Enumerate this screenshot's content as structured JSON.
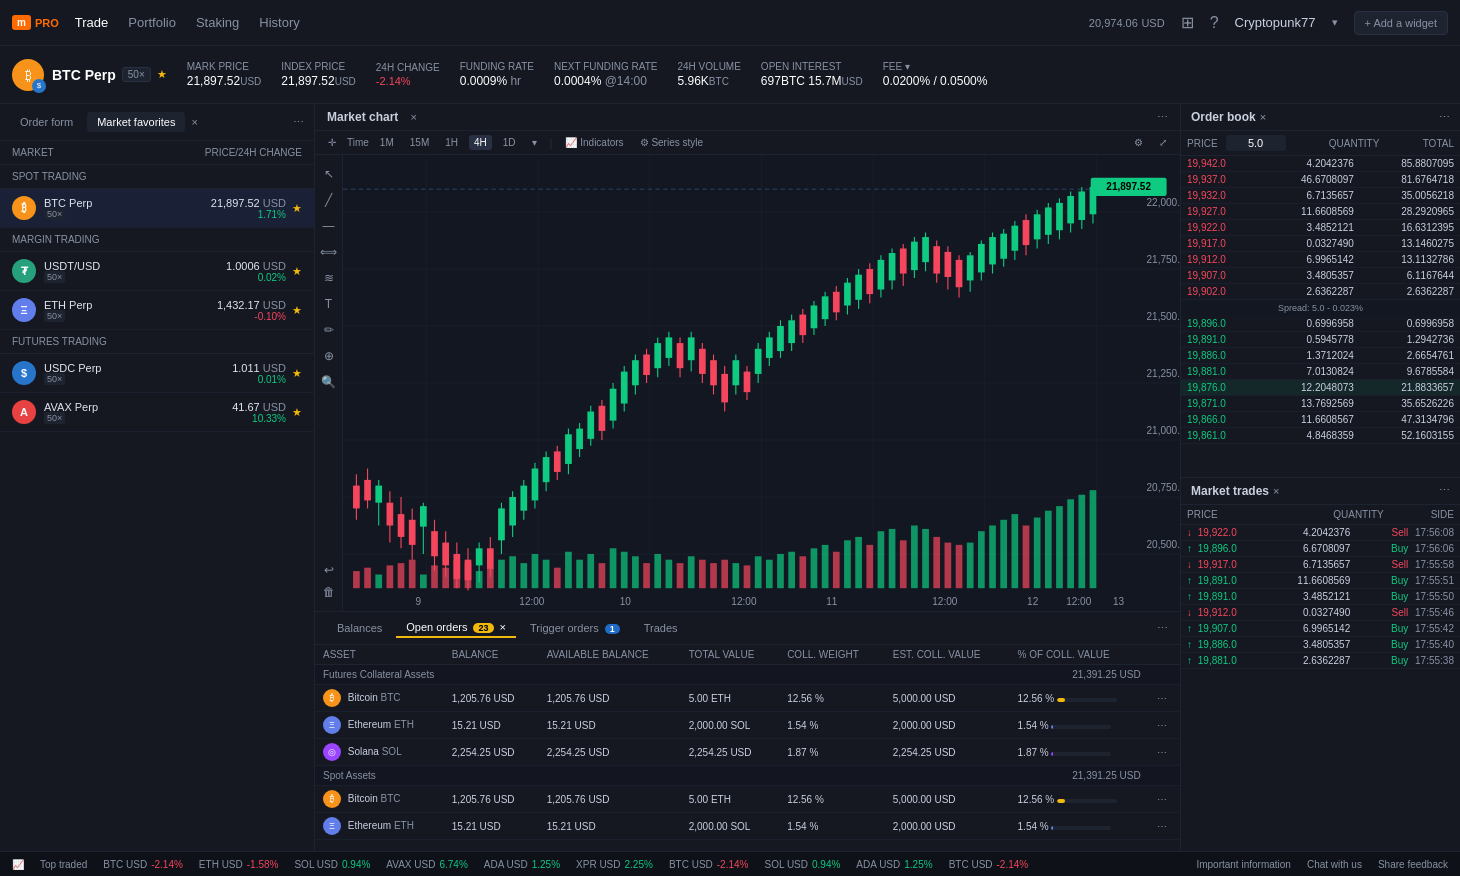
{
  "nav": {
    "logo": "m",
    "logo_pro": "PRO",
    "trade": "Trade",
    "portfolio": "Portfolio",
    "staking": "Staking",
    "history": "History",
    "balance": "20,974.06",
    "balance_currency": "USD",
    "username": "Cryptopunk77",
    "add_widget": "+ Add a widget"
  },
  "market_bar": {
    "asset": "BTC Perp",
    "leverage": "50×",
    "mark_price_label": "MARK PRICE",
    "mark_price": "21,897.52",
    "mark_price_cur": "USD",
    "index_price_label": "INDEX PRICE",
    "index_price": "21,897.52",
    "index_price_cur": "USD",
    "change_label": "24H CHANGE",
    "change": "-2.14%",
    "funding_label": "FUNDING RATE",
    "funding": "0.0009%",
    "funding_interval": "hr",
    "next_funding_label": "NEXT FUNDING RATE",
    "next_funding": "0.0004%",
    "next_funding_time": "@14:00",
    "volume_label": "24H VOLUME",
    "volume": "5.96K",
    "volume_cur": "BTC",
    "oi_label": "OPEN INTEREST",
    "oi_btc": "697BTC",
    "oi_usd": "15.7M",
    "oi_cur": "USD",
    "fee_label": "FEE ▾",
    "fee": "0.0200% / 0.0500%"
  },
  "left_panel": {
    "tab_order_form": "Order form",
    "tab_market_fav": "Market favorites",
    "col_market": "MARKET",
    "col_price": "PRICE/24H CHANGE",
    "section_spot": "SPOT TRADING",
    "section_margin": "MARGIN TRADING",
    "section_futures": "FUTURES TRADING",
    "markets": [
      {
        "name": "BTC Perp",
        "lev": "50×",
        "price": "21,897.52",
        "cur": "USD",
        "change": "1.71%",
        "pos": true,
        "color": "#f7931a",
        "section": "spot"
      },
      {
        "name": "USDT/USD",
        "lev": "50×",
        "price": "1.0006",
        "cur": "USD",
        "change": "0.02%",
        "pos": true,
        "color": "#26a17b",
        "section": "margin"
      },
      {
        "name": "ETH Perp",
        "lev": "50×",
        "price": "1,432.17",
        "cur": "USD",
        "change": "-0.10%",
        "pos": false,
        "color": "#627eea",
        "section": "margin"
      },
      {
        "name": "USDC Perp",
        "lev": "50×",
        "price": "1.011",
        "cur": "USD",
        "change": "0.01%",
        "pos": true,
        "color": "#2775ca",
        "section": "futures"
      },
      {
        "name": "AVAX Perp",
        "lev": "50×",
        "price": "41.67",
        "cur": "USD",
        "change": "10.33%",
        "pos": true,
        "color": "#e84142",
        "section": "futures"
      }
    ]
  },
  "chart": {
    "title": "Market chart",
    "time_label": "Time",
    "timeframes": [
      "1M",
      "15M",
      "1H",
      "4H",
      "1D"
    ],
    "active_tf": "4H",
    "indicators": "Indicators",
    "series_style": "Series style",
    "price_label": "22,000.00",
    "current_price": "21,897.52"
  },
  "order_book": {
    "title": "Order book",
    "col_price": "PRICE",
    "col_qty": "QUANTITY",
    "col_total": "TOTAL",
    "spread_label": "Spread: 5.0 - 0.023%",
    "price_input": "5.0",
    "asks": [
      {
        "price": "19,942.0",
        "qty": "4.2042376",
        "total": "85.8807095"
      },
      {
        "price": "19,937.0",
        "qty": "46.6708097",
        "total": "81.6764718"
      },
      {
        "price": "19,932.0",
        "qty": "6.7135657",
        "total": "35.0056218"
      },
      {
        "price": "19,927.0",
        "qty": "11.6608569",
        "total": "28.2920965"
      },
      {
        "price": "19,922.0",
        "qty": "3.4852121",
        "total": "16.6312395"
      },
      {
        "price": "19,917.0",
        "qty": "0.0327490",
        "total": "13.1460275"
      },
      {
        "price": "19,912.0",
        "qty": "6.9965142",
        "total": "13.1132786"
      },
      {
        "price": "19,907.0",
        "qty": "3.4805357",
        "total": "6.1167644"
      },
      {
        "price": "19,902.0",
        "qty": "2.6362287",
        "total": "2.6362287"
      }
    ],
    "bids": [
      {
        "price": "19,896.0",
        "qty": "0.6996958",
        "total": "0.6996958"
      },
      {
        "price": "19,891.0",
        "qty": "0.5945778",
        "total": "1.2942736"
      },
      {
        "price": "19,886.0",
        "qty": "1.3712024",
        "total": "2.6654761"
      },
      {
        "price": "19,881.0",
        "qty": "7.0130824",
        "total": "9.6785584"
      },
      {
        "price": "19,876.0",
        "qty": "12.2048073",
        "total": "21.8833657",
        "highlight": true
      },
      {
        "price": "19,871.0",
        "qty": "13.7692569",
        "total": "35.6526226"
      },
      {
        "price": "19,866.0",
        "qty": "11.6608567",
        "total": "47.3134796"
      },
      {
        "price": "19,861.0",
        "qty": "4.8468359",
        "total": "52.1603155"
      }
    ]
  },
  "bottom_panel": {
    "tab_balances": "Balances",
    "tab_open_orders": "Open orders",
    "tab_open_count": "23",
    "tab_trigger": "Trigger orders",
    "tab_trigger_count": "1",
    "tab_trades": "Trades",
    "section_futures": "Futures Collateral Assets",
    "section_futures_total": "21,391.25 USD",
    "section_spot": "Spot Assets",
    "section_spot_total": "21,391.25 USD",
    "col_asset": "ASSET",
    "col_balance": "BALANCE",
    "col_avail": "AVAILABLE BALANCE",
    "col_total_val": "TOTAL VALUE",
    "col_coll_weight": "COLL. WEIGHT",
    "col_est_coll": "EST. COLL. VALUE",
    "col_pct_coll": "% OF COLL. VALUE",
    "rows": [
      {
        "asset": "Bitcoin BTC",
        "balance": "1,205.76 USD",
        "avail": "1,205.76 USD",
        "total_val": "5.00 ETH",
        "coll_weight": "12.56 %",
        "est_coll": "5,000.00 USD",
        "pct_coll": "12.56 %",
        "bar_color": "#f0b90b",
        "bar_pct": 13
      },
      {
        "asset": "Ethereum ETH",
        "balance": "15.21 USD",
        "avail": "15.21 USD",
        "total_val": "2,000.00 SOL",
        "coll_weight": "1.54 %",
        "est_coll": "2,000.00 USD",
        "pct_coll": "1.54 %",
        "bar_color": "#627eea",
        "bar_pct": 2
      },
      {
        "asset": "Solana SOL",
        "balance": "2,254.25 USD",
        "avail": "2,254.25 USD",
        "total_val": "2,254.25 USD",
        "coll_weight": "1.87 %",
        "est_coll": "2,254.25 USD",
        "pct_coll": "1.87 %",
        "bar_color": "#9945ff",
        "bar_pct": 2
      },
      {
        "asset": "Bitcoin BTC",
        "balance": "1,205.76 USD",
        "avail": "1,205.76 USD",
        "total_val": "5.00 ETH",
        "coll_weight": "12.56 %",
        "est_coll": "5,000.00 USD",
        "pct_coll": "12.56 %",
        "bar_color": "#f0b90b",
        "bar_pct": 13
      },
      {
        "asset": "Ethereum ETH",
        "balance": "15.21 USD",
        "avail": "15.21 USD",
        "total_val": "2,000.00 SOL",
        "coll_weight": "1.54 %",
        "est_coll": "2,000.00 USD",
        "pct_coll": "1.54 %",
        "bar_color": "#627eea",
        "bar_pct": 2
      }
    ]
  },
  "market_trades": {
    "title": "Market trades",
    "col_price": "PRICE",
    "col_qty": "QUANTITY",
    "col_side": "SIDE",
    "rows": [
      {
        "price": "19,922.0",
        "qty": "4.2042376",
        "side": "Sell",
        "time": "17:56:08",
        "dir": "down"
      },
      {
        "price": "19,896.0",
        "qty": "6.6708097",
        "side": "Buy",
        "time": "17:56:06",
        "dir": "up"
      },
      {
        "price": "19,917.0",
        "qty": "6.7135657",
        "side": "Sell",
        "time": "17:55:58",
        "dir": "down"
      },
      {
        "price": "19,891.0",
        "qty": "11.6608569",
        "side": "Buy",
        "time": "17:55:51",
        "dir": "up"
      },
      {
        "price": "19,891.0",
        "qty": "3.4852121",
        "side": "Buy",
        "time": "17:55:50",
        "dir": "up"
      },
      {
        "price": "19,912.0",
        "qty": "0.0327490",
        "side": "Sell",
        "time": "17:55:46",
        "dir": "down"
      },
      {
        "price": "19,907.0",
        "qty": "6.9965142",
        "side": "Buy",
        "time": "17:55:42",
        "dir": "up"
      },
      {
        "price": "19,886.0",
        "qty": "3.4805357",
        "side": "Buy",
        "time": "17:55:40",
        "dir": "up"
      },
      {
        "price": "19,881.0",
        "qty": "2.6362287",
        "side": "Buy",
        "time": "17:55:38",
        "dir": "up"
      }
    ]
  },
  "ticker": {
    "items": [
      {
        "symbol": "BTC USD",
        "change": "-2.14%",
        "pos": false
      },
      {
        "symbol": "ETH USD",
        "change": "-1.58%",
        "pos": false
      },
      {
        "symbol": "SOL USD",
        "change": "0.94%",
        "pos": true
      },
      {
        "symbol": "AVAX USD",
        "change": "6.74%",
        "pos": true
      },
      {
        "symbol": "ADA USD",
        "change": "1.25%",
        "pos": true
      },
      {
        "symbol": "XPR USD",
        "change": "2.25%",
        "pos": true
      },
      {
        "symbol": "BTC USD",
        "change": "-2.14%",
        "pos": false
      },
      {
        "symbol": "SOL USD",
        "change": "0.94%",
        "pos": true
      },
      {
        "symbol": "ADA USD",
        "change": "1.25%",
        "pos": true
      },
      {
        "symbol": "BTC USD",
        "change": "-2.14%",
        "pos": false
      }
    ],
    "links": [
      "Important information",
      "Chat with us",
      "Share feedback"
    ]
  }
}
